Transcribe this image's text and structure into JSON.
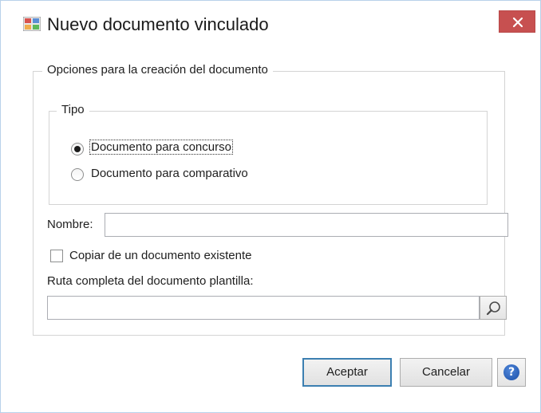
{
  "window": {
    "title": "Nuevo documento vinculado",
    "close_icon": "close-icon",
    "app_icon": "app-icon"
  },
  "options_group": {
    "legend": "Opciones para la creación del documento"
  },
  "tipo_group": {
    "legend": "Tipo",
    "options": [
      {
        "label": "Documento para concurso",
        "checked": true
      },
      {
        "label": "Documento para comparativo",
        "checked": false
      }
    ]
  },
  "nombre": {
    "label": "Nombre:",
    "value": ""
  },
  "copiar": {
    "label": "Copiar de un documento existente",
    "checked": false
  },
  "ruta": {
    "label": "Ruta completa del documento plantilla:",
    "value": "",
    "browse_icon": "search-icon"
  },
  "buttons": {
    "accept": "Aceptar",
    "cancel": "Cancelar",
    "help": "?"
  },
  "colors": {
    "close_button": "#c75050",
    "default_button_border": "#3c7fb1",
    "help_icon": "#1a4fa8"
  }
}
